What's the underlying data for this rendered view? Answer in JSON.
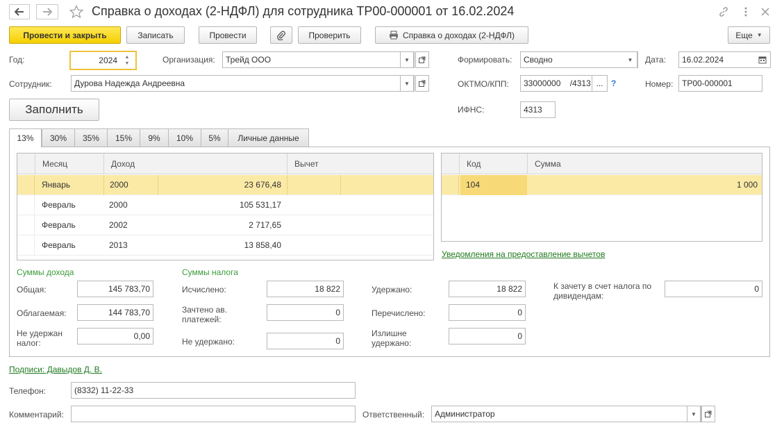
{
  "window": {
    "title": "Справка о доходах (2-НДФЛ) для сотрудника ТР00-000001 от 16.02.2024",
    "icons": [
      "back-arrow-icon",
      "forward-arrow-icon",
      "star-icon",
      "link-icon",
      "more-vertical-icon",
      "close-icon"
    ]
  },
  "toolbar": {
    "post_close": "Провести и закрыть",
    "save": "Записать",
    "post": "Провести",
    "check": "Проверить",
    "print_report": "Справка о доходах (2-НДФЛ)",
    "more": "Еще"
  },
  "header": {
    "year_label": "Год:",
    "year_value": "2024",
    "org_label": "Организация:",
    "org_value": "Трейд ООО",
    "form_label": "Формировать:",
    "form_value": "Сводно",
    "date_label": "Дата:",
    "date_value": "16.02.2024",
    "employee_label": "Сотрудник:",
    "employee_value": "Дурова Надежда Андреевна",
    "oktmo_label": "ОКТМО/КПП:",
    "oktmo_value": "33000000    /4313",
    "oktmo_select": "...",
    "help": "?",
    "number_label": "Номер:",
    "number_value": "ТР00-000001",
    "fill_button": "Заполнить",
    "ifns_label": "ИФНС:",
    "ifns_value": "4313"
  },
  "tabs": [
    {
      "label": "13%",
      "active": true
    },
    {
      "label": "30%"
    },
    {
      "label": "35%"
    },
    {
      "label": "15%"
    },
    {
      "label": "9%"
    },
    {
      "label": "10%"
    },
    {
      "label": "5%"
    },
    {
      "label": "Личные данные"
    }
  ],
  "income_table": {
    "columns": [
      "Месяц",
      "Доход",
      "Вычет"
    ],
    "rows": [
      {
        "month": "Январь",
        "code": "2000",
        "amount": "23 676,48"
      },
      {
        "month": "Февраль",
        "code": "2000",
        "amount": "105 531,17"
      },
      {
        "month": "Февраль",
        "code": "2002",
        "amount": "2 717,65"
      },
      {
        "month": "Февраль",
        "code": "2013",
        "amount": "13 858,40"
      }
    ]
  },
  "deduction_table": {
    "columns": [
      "Код",
      "Сумма"
    ],
    "rows": [
      {
        "code": "104",
        "sum": "1 000"
      }
    ]
  },
  "notifications_link": "Уведомления на предоставление вычетов",
  "income_sums": {
    "title": "Суммы дохода",
    "total_label": "Общая:",
    "total_value": "145 783,70",
    "taxable_label": "Облагаемая:",
    "taxable_value": "144 783,70",
    "not_withheld_label": "Не удержан налог:",
    "not_withheld_value": "0,00"
  },
  "tax_sums": {
    "title": "Суммы налога",
    "calculated_label": "Исчислено:",
    "calculated_value": "18 822",
    "advance_label": "Зачтено ав. платежей:",
    "advance_value": "0",
    "not_withheld_label": "Не удержано:",
    "not_withheld_value": "0",
    "withheld_label": "Удержано:",
    "withheld_value": "18 822",
    "transferred_label": "Перечислено:",
    "transferred_value": "0",
    "excess_label": "Излишне удержано:",
    "excess_value": "0",
    "dividends_label": "К зачету в счет налога по дивидендам:",
    "dividends_value": "0"
  },
  "footer": {
    "signatures_link": "Подписи: Давыдов Д. В.",
    "phone_label": "Телефон:",
    "phone_value": "(8332) 11-22-33",
    "comment_label": "Комментарий:",
    "comment_value": "",
    "responsible_label": "Ответственный:",
    "responsible_value": "Администратор"
  },
  "colors": {
    "accent_yellow": "#f5cf00",
    "selected_row": "#fbeaa5",
    "section_green": "#3a9b3a",
    "link_green": "#1f7a1f",
    "focus_border": "#f0c23b"
  }
}
